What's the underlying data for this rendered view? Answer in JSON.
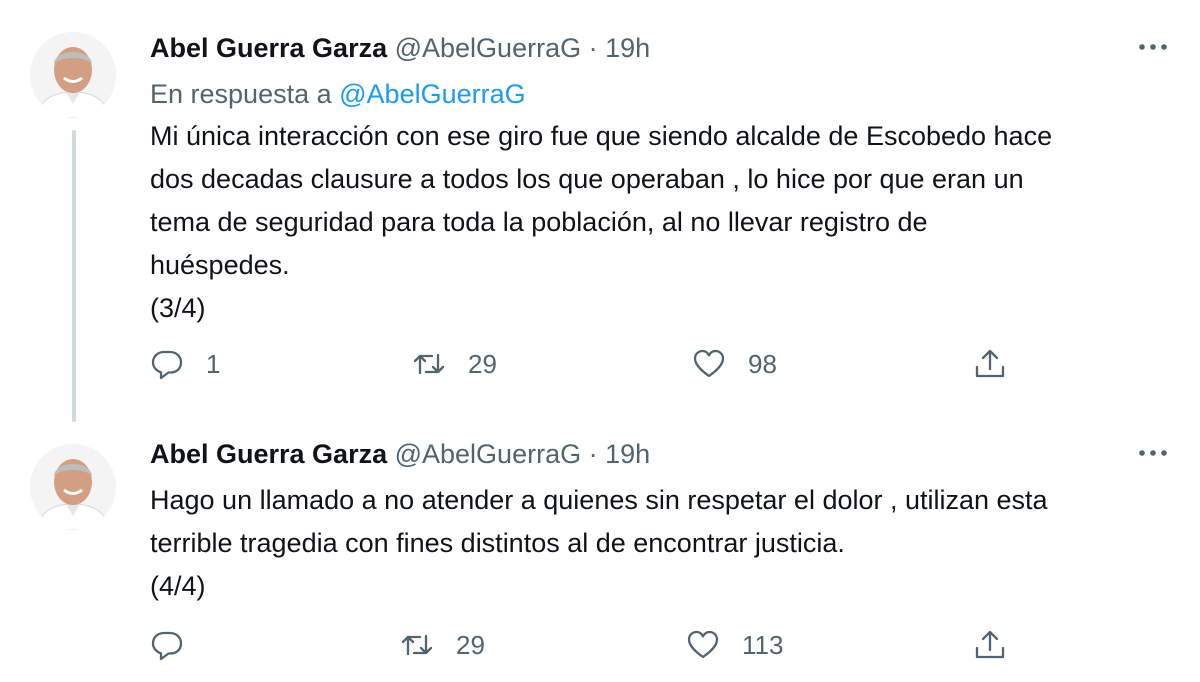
{
  "tweets": [
    {
      "author": {
        "name": "Abel Guerra Garza",
        "handle": "@AbelGuerraG",
        "separator": "·",
        "time": "19h"
      },
      "reply_to": {
        "prefix": "En respuesta a",
        "mention": "@AbelGuerraG"
      },
      "text_lines": [
        "Mi única interacción con ese giro fue  que siendo alcalde de Escobedo hace",
        "dos decadas clausure a todos los que operaban , lo hice por que eran un",
        "tema de seguridad para toda la población, al no llevar registro de",
        "huéspedes.",
        "(3/4)"
      ],
      "actions": {
        "reply": "1",
        "retweet": "29",
        "like": "98",
        "share": ""
      }
    },
    {
      "author": {
        "name": "Abel Guerra Garza",
        "handle": "@AbelGuerraG",
        "separator": "·",
        "time": "19h"
      },
      "text_lines": [
        "Hago un llamado a no atender a quienes sin respetar el dolor , utilizan esta",
        "terrible tragedia con fines distintos al de encontrar justicia.",
        "(4/4)"
      ],
      "actions": {
        "reply": "",
        "retweet": "29",
        "like": "113",
        "share": ""
      }
    }
  ],
  "icons": {
    "more": "more-horizontal-icon",
    "reply": "reply-bubble-icon",
    "retweet": "retweet-arrows-icon",
    "like": "heart-icon",
    "share": "share-upload-icon"
  },
  "colors": {
    "text": "#0f1419",
    "secondary": "#536471",
    "link": "#1d9bf0",
    "thread_line": "#cfd9de"
  }
}
